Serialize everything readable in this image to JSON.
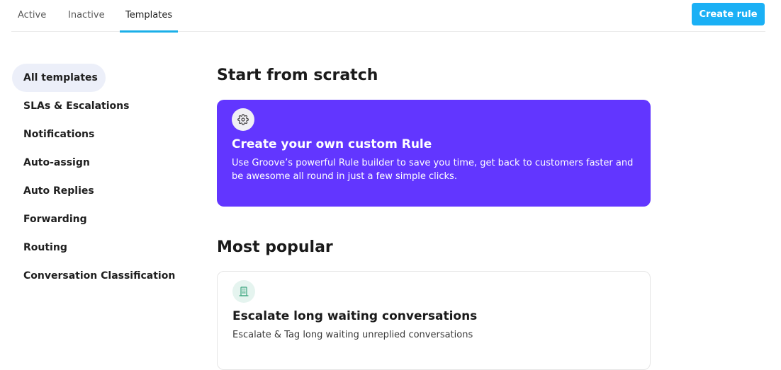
{
  "tabs": {
    "active_label": "Active",
    "inactive_label": "Inactive",
    "templates_label": "Templates"
  },
  "header": {
    "create_rule_label": "Create rule"
  },
  "colors": {
    "accent_tab_underline": "#1aafe8",
    "create_button": "#1ab0f5",
    "custom_card_bg": "#6236ff",
    "sidebar_selected_bg": "#eceff9"
  },
  "sidebar": {
    "items": [
      {
        "label": "All templates",
        "selected": true
      },
      {
        "label": "SLAs & Escalations"
      },
      {
        "label": "Notifications"
      },
      {
        "label": "Auto-assign"
      },
      {
        "label": "Auto Replies"
      },
      {
        "label": "Forwarding"
      },
      {
        "label": "Routing"
      },
      {
        "label": "Conversation Classification"
      }
    ]
  },
  "main": {
    "scratch_section_title": "Start from scratch",
    "custom_card": {
      "icon": "gear-icon",
      "title": "Create your own custom Rule",
      "description": "Use Groove’s powerful Rule builder to save you time, get back to customers faster and be awesome all round in just a few simple clicks."
    },
    "popular_section_title": "Most popular",
    "templates": [
      {
        "icon": "building-icon",
        "title": "Escalate long waiting conversations",
        "description": "Escalate & Tag long waiting unreplied conversations"
      }
    ]
  }
}
